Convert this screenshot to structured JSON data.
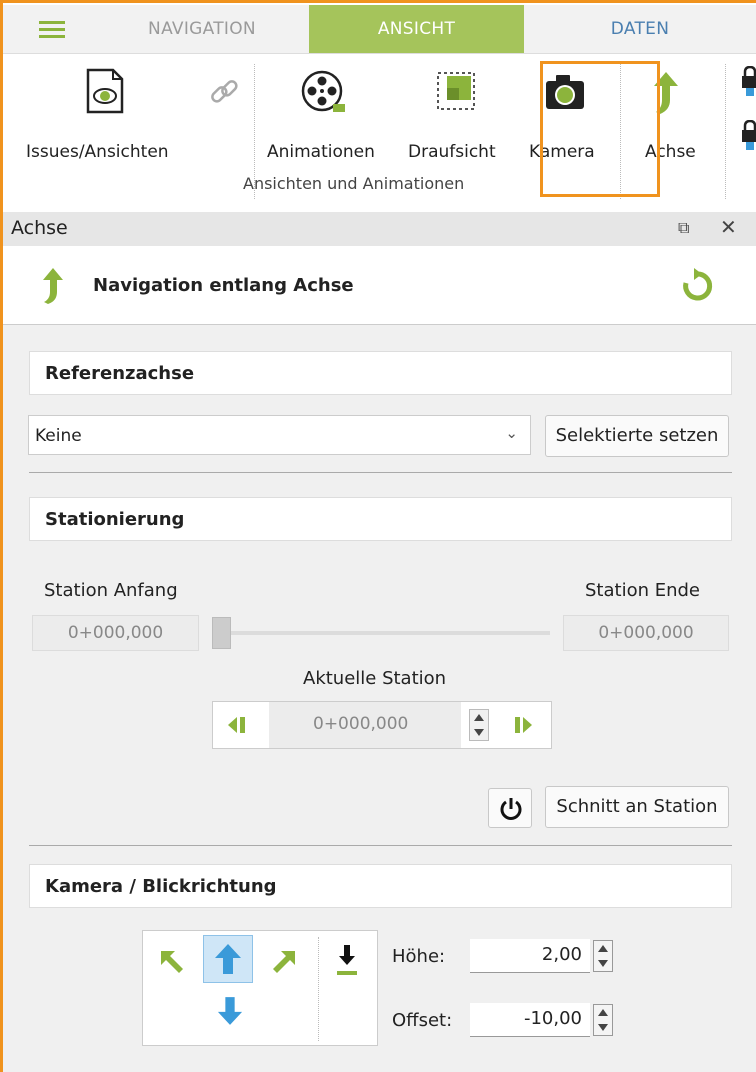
{
  "tabs": {
    "navigation": "NAVIGATION",
    "ansicht": "ANSICHT",
    "daten": "DATEN"
  },
  "ribbon": {
    "issues": "Issues/Ansichten",
    "animationen": "Animationen",
    "draufsicht": "Draufsicht",
    "kamera": "Kamera",
    "achse": "Achse",
    "group_label": "Ansichten und Animationen"
  },
  "panel": {
    "title": "Achse",
    "heading": "Navigation entlang Achse",
    "referenz": {
      "title": "Referenzachse",
      "combo_value": "Keine",
      "set_button": "Selektierte setzen"
    },
    "stationierung": {
      "title": "Stationierung",
      "start_label": "Station Anfang",
      "end_label": "Station Ende",
      "start_value": "0+000,000",
      "end_value": "0+000,000",
      "current_label": "Aktuelle Station",
      "current_value": "0+000,000",
      "slider_position": 0,
      "cut_button": "Schnitt an Station"
    },
    "kamera": {
      "title": "Kamera / Blickrichtung",
      "hoehe_label": "Höhe:",
      "hoehe_value": "2,00",
      "offset_label": "Offset:",
      "offset_value": "-10,00"
    }
  },
  "colors": {
    "accent_green": "#8cb43c",
    "tab_active": "#a5c45b",
    "highlight": "#f0931e",
    "blue": "#3a9ad9"
  }
}
